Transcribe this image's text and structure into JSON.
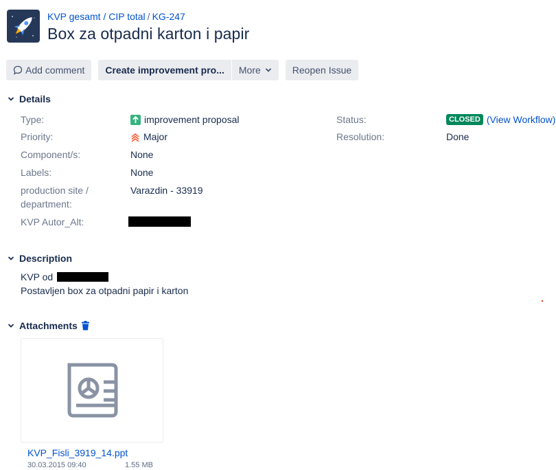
{
  "breadcrumb": {
    "project": "KVP gesamt / CIP total",
    "separator": "/",
    "issue_key": "KG-247"
  },
  "issue": {
    "title": "Box za otpadni karton i papir"
  },
  "toolbar": {
    "add_comment": "Add comment",
    "create_improvement": "Create improvement pro...",
    "more": "More",
    "reopen": "Reopen Issue"
  },
  "details": {
    "heading": "Details",
    "type_label": "Type:",
    "type_value": "improvement proposal",
    "priority_label": "Priority:",
    "priority_value": "Major",
    "components_label": "Component/s:",
    "components_value": "None",
    "labels_label": "Labels:",
    "labels_value": "None",
    "site_label_line1": "production site /",
    "site_label_line2": "department:",
    "site_value": "Varazdin - 33919",
    "autor_label": "KVP Autor_Alt:",
    "status_label": "Status:",
    "status_value": "CLOSED",
    "view_workflow": "(View Workflow)",
    "resolution_label": "Resolution:",
    "resolution_value": "Done"
  },
  "description": {
    "heading": "Description",
    "line1_prefix": "KVP od",
    "line2": "Postavljen box za otpadni papir i karton"
  },
  "attachments": {
    "heading": "Attachments",
    "file_name": "KVP_Fisli_3919_14.ppt",
    "date": "30.03.2015 09:40",
    "size": "1.55 MB"
  },
  "colors": {
    "accent": "#0052cc",
    "closed_lozenge": "#00875a",
    "improvement_icon": "#36b37e",
    "priority_major": "#ff5630",
    "button_bg": "#ebecf0"
  }
}
